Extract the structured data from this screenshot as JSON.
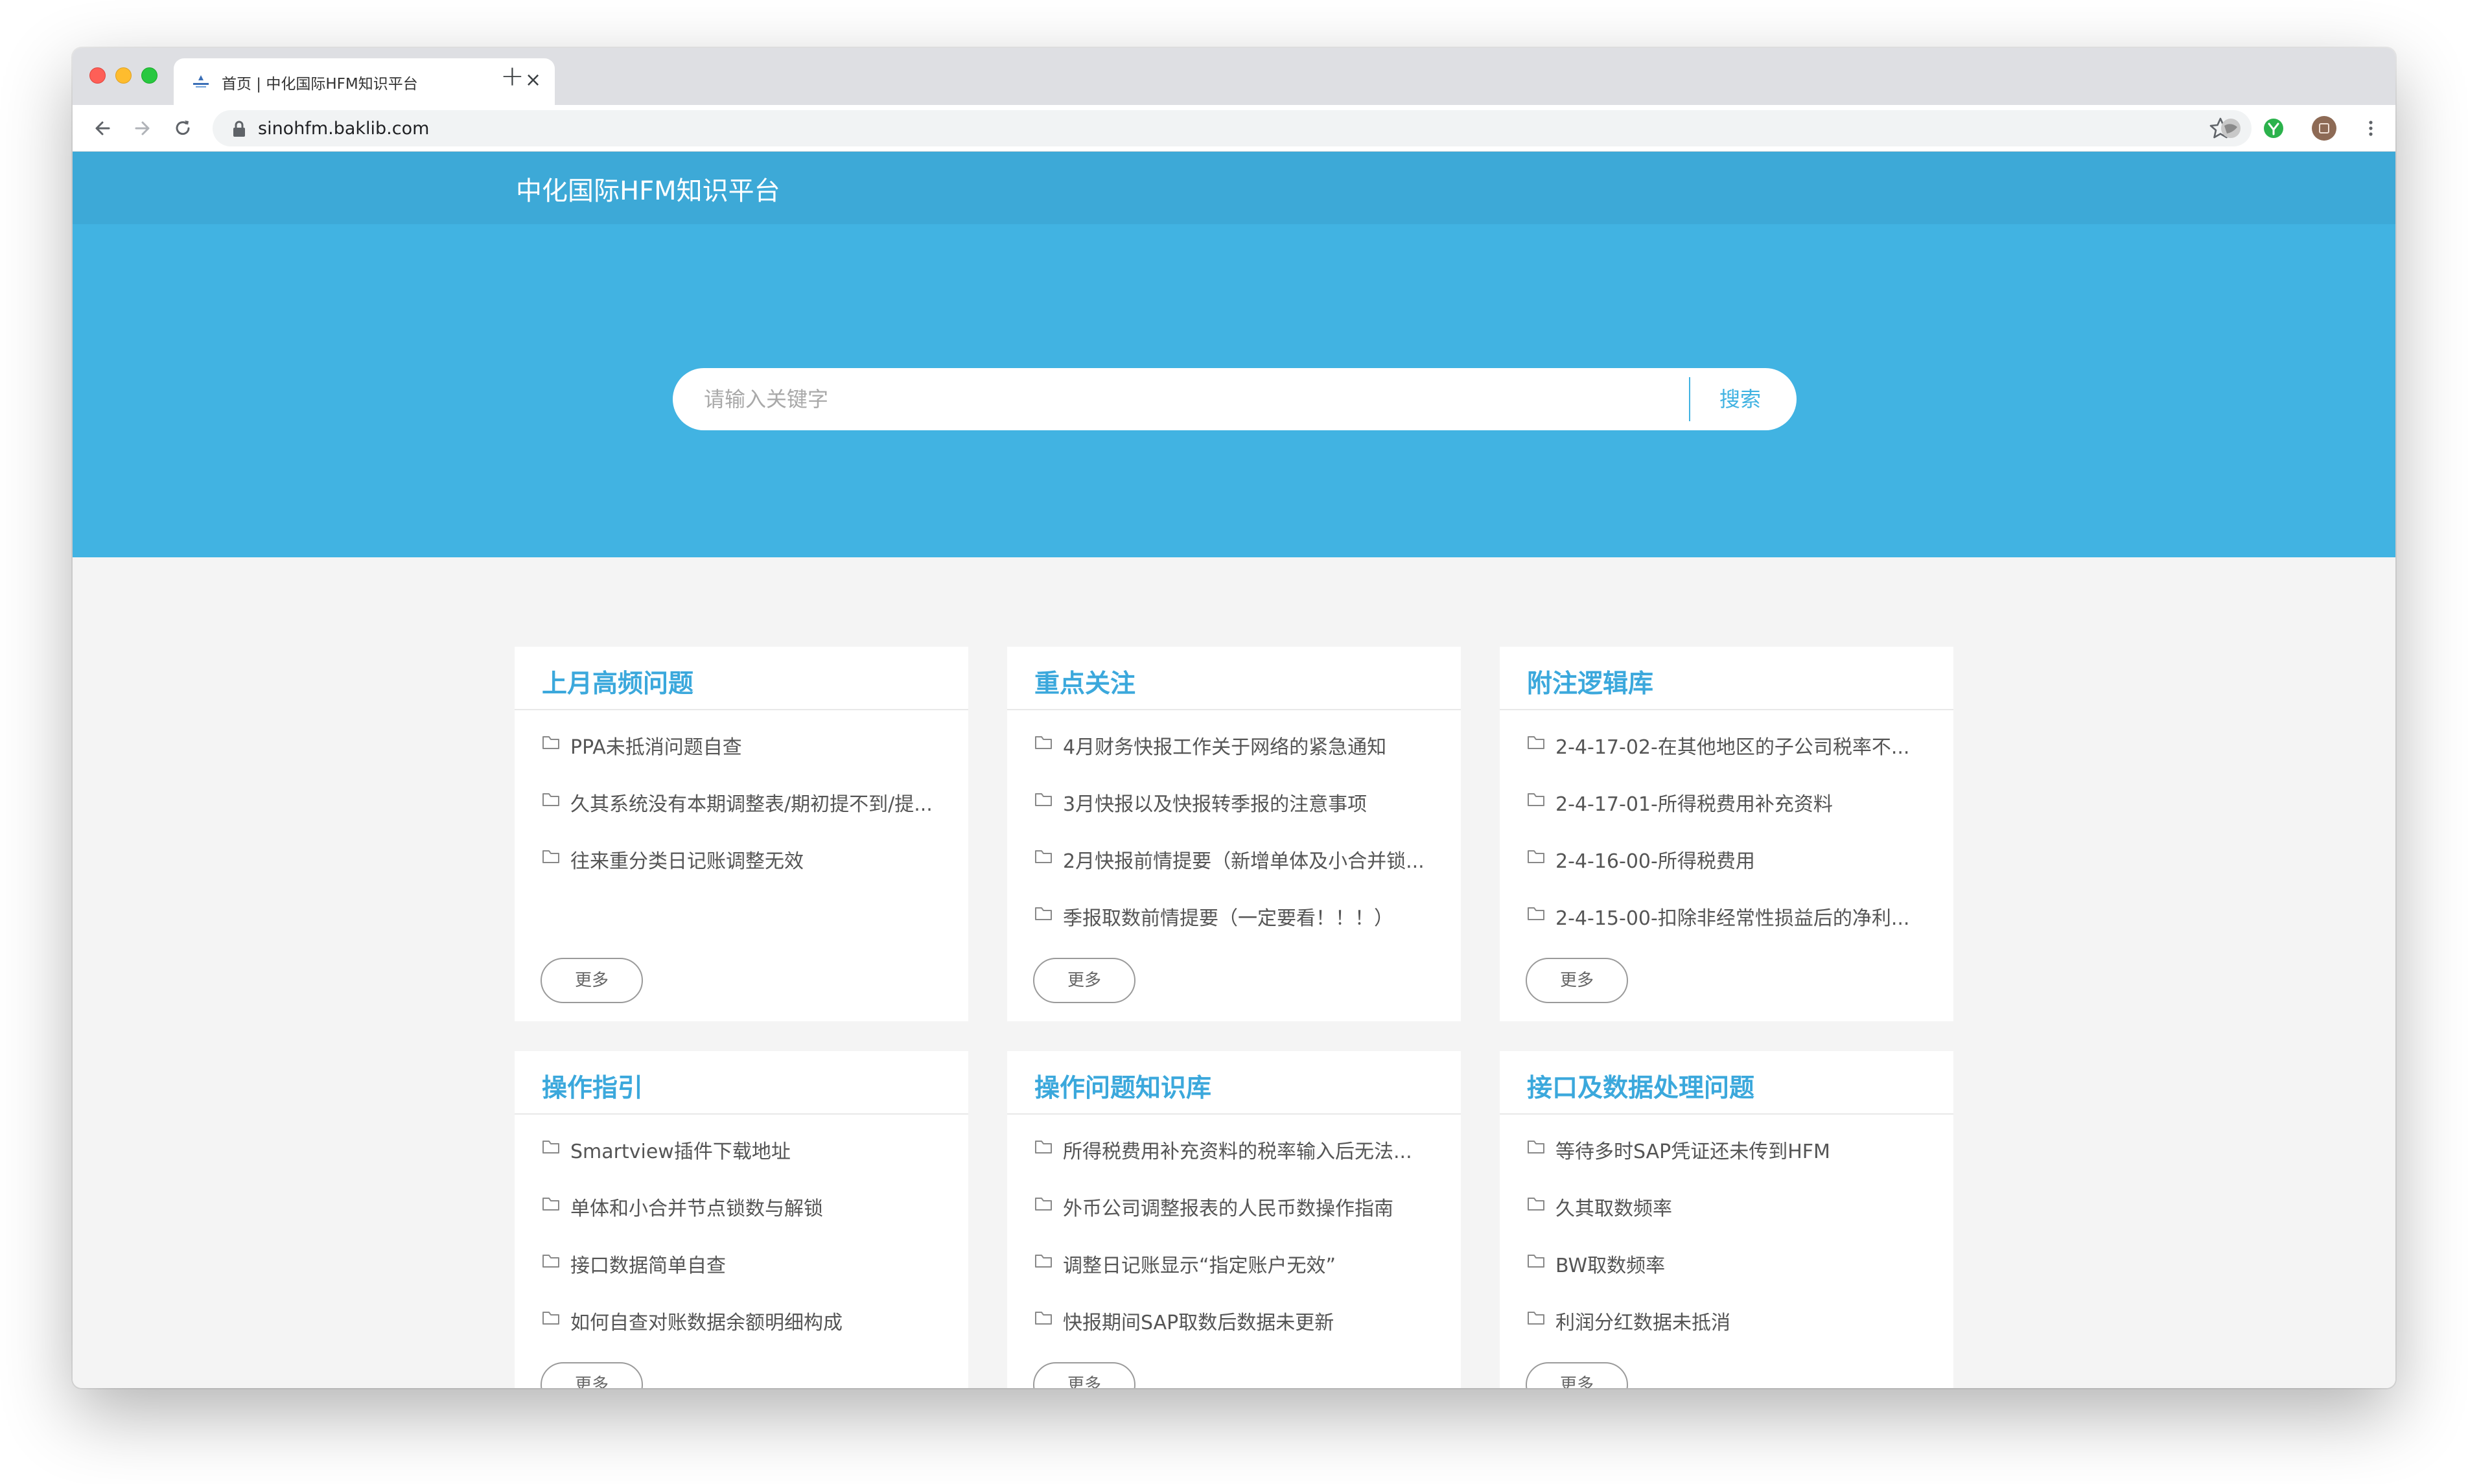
{
  "browser": {
    "tab_title": "首页 | 中化国际HFM知识平台",
    "url": "sinohfm.baklib.com",
    "close_glyph": "×",
    "newtab_glyph": "+"
  },
  "site": {
    "title": "中化国际HFM知识平台"
  },
  "search": {
    "placeholder": "请输入关键字",
    "button": "搜索"
  },
  "cards": [
    {
      "title": "上月高频问题",
      "items": [
        "PPA未抵消问题自查",
        "久其系统没有本期调整表/期初提不到/提...",
        "往来重分类日记账调整无效"
      ],
      "more": "更多"
    },
    {
      "title": "重点关注",
      "items": [
        "4月财务快报工作关于网络的紧急通知",
        "3月快报以及快报转季报的注意事项",
        "2月快报前情提要（新增单体及小合并锁...",
        "季报取数前情提要（一定要看！！！）"
      ],
      "more": "更多"
    },
    {
      "title": "附注逻辑库",
      "items": [
        "2-4-17-02-在其他地区的子公司税率不...",
        "2-4-17-01-所得税费用补充资料",
        "2-4-16-00-所得税费用",
        "2-4-15-00-扣除非经常性损益后的净利..."
      ],
      "more": "更多"
    },
    {
      "title": "操作指引",
      "items": [
        "Smartview插件下载地址",
        "单体和小合并节点锁数与解锁",
        "接口数据简单自查",
        "如何自查对账数据余额明细构成"
      ],
      "more": "更多"
    },
    {
      "title": "操作问题知识库",
      "items": [
        "所得税费用补充资料的税率输入后无法...",
        "外币公司调整报表的人民币数操作指南",
        "调整日记账显示“指定账户无效”",
        "快报期间SAP取数后数据未更新"
      ],
      "more": "更多"
    },
    {
      "title": "接口及数据处理问题",
      "items": [
        "等待多时SAP凭证还未传到HFM",
        "久其取数频率",
        "BW取数频率",
        "利润分红数据未抵消"
      ],
      "more": "更多"
    }
  ],
  "colors": {
    "header": "#3da9d7",
    "hero": "#41b3e2",
    "card_title": "#3ba8dc",
    "page_bg": "#f4f4f4"
  }
}
